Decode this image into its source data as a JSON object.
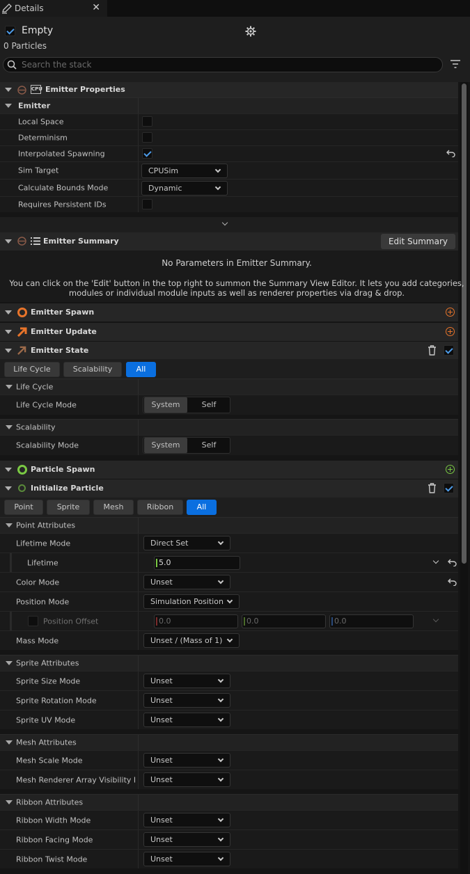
{
  "tab": {
    "title": "Details",
    "close": "✕"
  },
  "header": {
    "emitter_name": "Empty",
    "particle_count": "0 Particles",
    "search_placeholder": "Search the stack"
  },
  "emitter_properties": {
    "title": "Emitter Properties",
    "cpu_badge": "CPU",
    "category": "Emitter",
    "rows": {
      "local_space": "Local Space",
      "determinism": "Determinism",
      "interpolated_spawning": "Interpolated Spawning",
      "sim_target": "Sim Target",
      "sim_target_value": "CPUSim",
      "calc_bounds": "Calculate Bounds Mode",
      "calc_bounds_value": "Dynamic",
      "persistent_ids": "Requires Persistent IDs"
    }
  },
  "emitter_summary": {
    "title": "Emitter Summary",
    "edit_button": "Edit Summary",
    "empty_msg": "No Parameters in Emitter Summary.",
    "help_line1": "You can click on the 'Edit' button in the top right to summon the Summary View Editor. It lets you add categories,",
    "help_line2": "modules or individual module inputs as well as renderer properties via drag & drop."
  },
  "modules": {
    "emitter_spawn": "Emitter Spawn",
    "emitter_update": "Emitter Update",
    "emitter_state": "Emitter State",
    "particle_spawn": "Particle Spawn",
    "initialize_particle": "Initialize Particle"
  },
  "emitter_state": {
    "tabs": [
      "Life Cycle",
      "Scalability",
      "All"
    ],
    "life_cycle_cat": "Life Cycle",
    "life_cycle_mode": "Life Cycle Mode",
    "scalability_cat": "Scalability",
    "scalability_mode": "Scalability Mode",
    "seg_system": "System",
    "seg_self": "Self"
  },
  "init_particle": {
    "tabs": [
      "Point",
      "Sprite",
      "Mesh",
      "Ribbon",
      "All"
    ],
    "point_cat": "Point Attributes",
    "lifetime_mode": "Lifetime Mode",
    "lifetime_mode_value": "Direct Set",
    "lifetime": "Lifetime",
    "lifetime_value": "5.0",
    "color_mode": "Color Mode",
    "color_mode_value": "Unset",
    "position_mode": "Position Mode",
    "position_mode_value": "Simulation Position",
    "position_offset": "Position Offset",
    "offset_x": "0.0",
    "offset_y": "0.0",
    "offset_z": "0.0",
    "mass_mode": "Mass Mode",
    "mass_mode_value": "Unset / (Mass of 1)",
    "sprite_cat": "Sprite Attributes",
    "sprite_size": "Sprite Size Mode",
    "sprite_rotation": "Sprite Rotation Mode",
    "sprite_uv": "Sprite UV Mode",
    "mesh_cat": "Mesh Attributes",
    "mesh_scale": "Mesh Scale Mode",
    "mesh_vis": "Mesh Renderer Array Visibility Mode",
    "ribbon_cat": "Ribbon Attributes",
    "ribbon_width": "Ribbon Width Mode",
    "ribbon_facing": "Ribbon Facing Mode",
    "ribbon_twist": "Ribbon Twist Mode",
    "unset": "Unset"
  },
  "colors": {
    "accent": "#0a6fe0",
    "spawn_orange": "#e8742a",
    "particle_green": "#7ac943",
    "state_brown": "#9c6a4a"
  }
}
